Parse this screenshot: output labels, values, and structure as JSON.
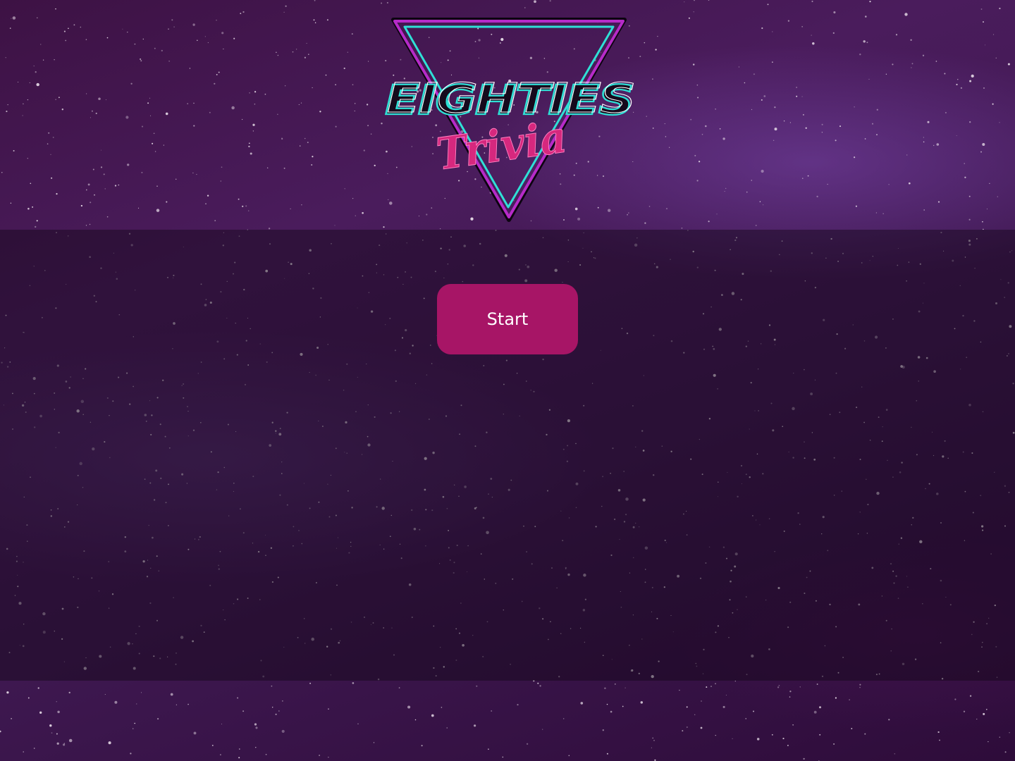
{
  "logo": {
    "title_word": "EIGHTIES",
    "subtitle_word": "Trivia"
  },
  "main": {
    "start_label": "Start"
  },
  "colors": {
    "accent_magenta": "#a71566",
    "neon_cyan": "#2fe0d6",
    "neon_pink": "#d6287e",
    "neon_purple": "#b62bc8",
    "panel_overlay": "#120616"
  }
}
